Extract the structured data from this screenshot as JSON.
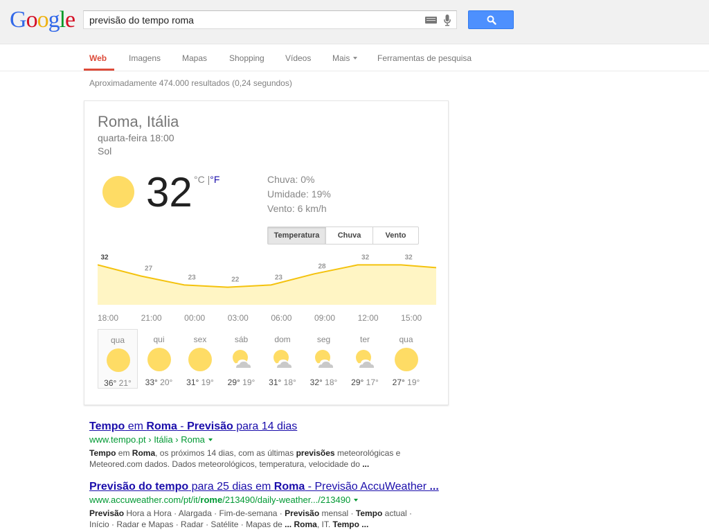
{
  "header": {
    "logo_letters": [
      {
        "ch": "G",
        "color": "#3369e8"
      },
      {
        "ch": "o",
        "color": "#d50f25"
      },
      {
        "ch": "o",
        "color": "#eeb211"
      },
      {
        "ch": "g",
        "color": "#3369e8"
      },
      {
        "ch": "l",
        "color": "#009925"
      },
      {
        "ch": "e",
        "color": "#d50f25"
      }
    ],
    "query": "previsão do tempo roma"
  },
  "nav": {
    "web": "Web",
    "images": "Imagens",
    "maps": "Mapas",
    "shopping": "Shopping",
    "videos": "Vídeos",
    "more": "Mais",
    "tools": "Ferramentas de pesquisa"
  },
  "stats": "Aproximadamente 474.000 resultados (0,24 segundos)",
  "weather": {
    "location": "Roma, Itália",
    "datetime": "quarta-feira 18:00",
    "condition": "Sol",
    "temperature": "32",
    "unit_c": "°C",
    "unit_sep": "|",
    "unit_f": "°F",
    "rain": "Chuva: 0%",
    "humidity": "Umidade: 19%",
    "wind": "Vento: 6 km/h",
    "tabs": {
      "temp": "Temperatura",
      "rain": "Chuva",
      "wind": "Vento"
    },
    "chart_data": {
      "type": "area",
      "x": [
        "18:00",
        "21:00",
        "00:00",
        "03:00",
        "06:00",
        "09:00",
        "12:00",
        "15:00"
      ],
      "values": [
        32,
        27,
        23,
        22,
        23,
        28,
        32,
        32
      ],
      "labels": [
        "32",
        "27",
        "23",
        "22",
        "23",
        "28",
        "32",
        "32"
      ],
      "line_color": "#f4c20d",
      "fill_color": "#fff5c4"
    },
    "days": [
      {
        "name": "qua",
        "icon": "sun-icon",
        "hi": "36°",
        "lo": "21°"
      },
      {
        "name": "qui",
        "icon": "sun-icon",
        "hi": "33°",
        "lo": "20°"
      },
      {
        "name": "sex",
        "icon": "sun-icon",
        "hi": "31°",
        "lo": "19°"
      },
      {
        "name": "sáb",
        "icon": "partly-cloudy-icon",
        "hi": "29°",
        "lo": "19°"
      },
      {
        "name": "dom",
        "icon": "partly-cloudy-icon",
        "hi": "31°",
        "lo": "18°"
      },
      {
        "name": "seg",
        "icon": "partly-cloudy-icon",
        "hi": "32°",
        "lo": "18°"
      },
      {
        "name": "ter",
        "icon": "partly-cloudy-icon",
        "hi": "29°",
        "lo": "17°"
      },
      {
        "name": "qua",
        "icon": "sun-icon",
        "hi": "27°",
        "lo": "19°"
      }
    ]
  },
  "results": [
    {
      "title": [
        {
          "t": "Tempo",
          "b": true
        },
        {
          "t": " em ",
          "b": false
        },
        {
          "t": "Roma",
          "b": true
        },
        {
          "t": " - ",
          "b": false
        },
        {
          "t": "Previsão",
          "b": true
        },
        {
          "t": " para 14 dias",
          "b": false
        }
      ],
      "url": [
        {
          "t": "www.tempo.pt › Itália › Roma",
          "b": false
        }
      ],
      "snippet_1": [
        {
          "t": "Tempo",
          "b": true
        },
        {
          "t": " em ",
          "b": false
        },
        {
          "t": "Roma",
          "b": true
        },
        {
          "t": ", os próximos 14 dias, com as últimas ",
          "b": false
        },
        {
          "t": "previsões",
          "b": true
        },
        {
          "t": " meteorológicas e",
          "b": false
        }
      ],
      "snippet_2": [
        {
          "t": "Meteored.com dados. Dados meteorológicos, temperatura, velocidade do ",
          "b": false
        },
        {
          "t": "...",
          "b": true
        }
      ]
    },
    {
      "title": [
        {
          "t": "Previsão do tempo",
          "b": true
        },
        {
          "t": " para 25 dias em ",
          "b": false
        },
        {
          "t": "Roma",
          "b": true
        },
        {
          "t": " - Previsão AccuWeather ",
          "b": false
        },
        {
          "t": "...",
          "b": true
        }
      ],
      "url": [
        {
          "t": "www.accuweather.com/pt/it/",
          "b": false
        },
        {
          "t": "rome",
          "b": true
        },
        {
          "t": "/213490/daily-weather.../213490",
          "b": false
        }
      ],
      "snippet_1": [
        {
          "t": "Previsão",
          "b": true
        },
        {
          "t": " Hora a Hora · Alargada · Fim-de-semana · ",
          "b": false
        },
        {
          "t": "Previsão",
          "b": true
        },
        {
          "t": " mensal · ",
          "b": false
        },
        {
          "t": "Tempo",
          "b": true
        },
        {
          "t": " actual ·",
          "b": false
        }
      ],
      "snippet_2": [
        {
          "t": "Início · Radar e Mapas · Radar · Satélite · Mapas de ",
          "b": false
        },
        {
          "t": "...",
          "b": true
        },
        {
          "t": " ",
          "b": false
        },
        {
          "t": "Roma",
          "b": true
        },
        {
          "t": ", IT. ",
          "b": false
        },
        {
          "t": "Tempo",
          "b": true
        },
        {
          "t": " ...",
          "b": true
        }
      ]
    }
  ]
}
